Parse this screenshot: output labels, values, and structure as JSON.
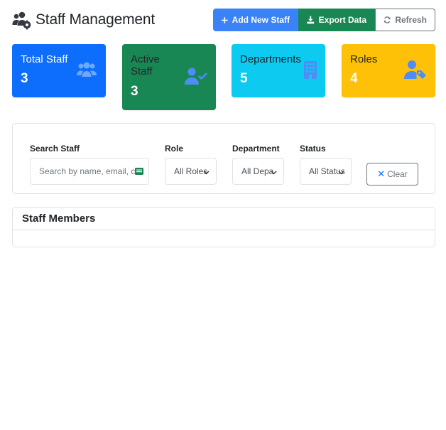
{
  "header": {
    "title": "Staff Management",
    "buttons": {
      "add": "Add New Staff",
      "export": "Export Data",
      "refresh": "Refresh"
    }
  },
  "stats": [
    {
      "label": "Total Staff",
      "value": "3",
      "icon": "users-icon",
      "color": "#0d6efd"
    },
    {
      "label": "Active Staff",
      "value": "3",
      "icon": "user-check-icon",
      "color": "#198754"
    },
    {
      "label": "Departments",
      "value": "5",
      "icon": "building-icon",
      "color": "#0dcaf0"
    },
    {
      "label": "Roles",
      "value": "4",
      "icon": "user-tag-icon",
      "color": "#ffc107"
    }
  ],
  "filters": {
    "search_label": "Search Staff",
    "search_placeholder": "Search by name, email, co",
    "role_label": "Role",
    "role_value": "All Roles",
    "department_label": "Department",
    "department_value": "All Depa",
    "status_label": "Status",
    "status_value": "All Status",
    "clear_label": "Clear"
  },
  "members": {
    "title": "Staff Members"
  }
}
